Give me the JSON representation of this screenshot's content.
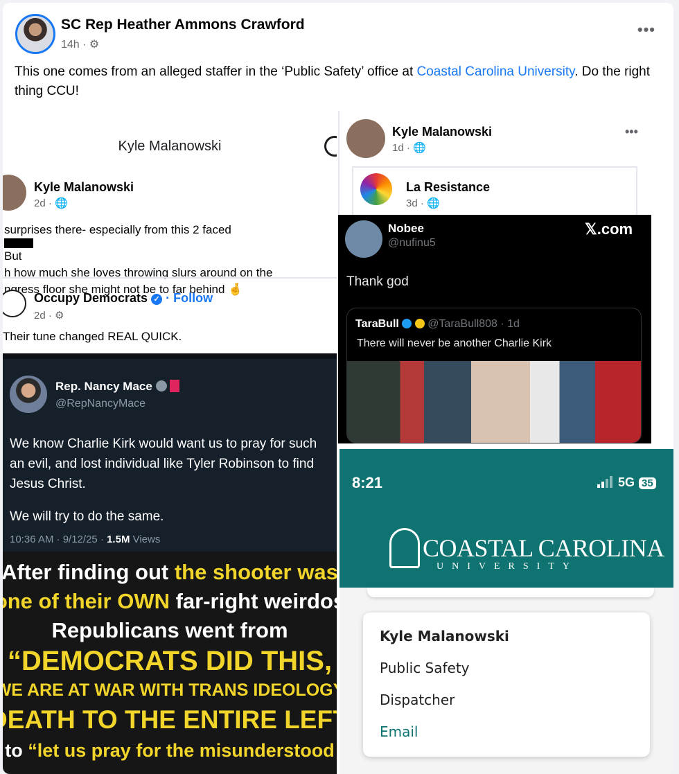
{
  "post": {
    "author": "SC Rep Heather Ammons Crawford",
    "time": "14h · ⚙",
    "more": "•••",
    "text_before": "This one comes from an alleged staffer in the ‘Public Safety’ office at ",
    "link": "Coastal Carolina University",
    "text_after": ". Do the right thing CCU!"
  },
  "left_screenshot": {
    "title": "Kyle Malanowski",
    "post_author": "Kyle Malanowski",
    "post_time": "2d · 🌐",
    "lines": [
      "surprises there- especially from this 2 faced",
      "But",
      "h how much she loves throwing slurs around on the",
      "ngress floor she might not be to far behind 🤞"
    ],
    "shared_page": "Occupy Democrats",
    "shared_follow": "· Follow",
    "shared_time": "2d · ⚙",
    "shared_text": "Their tune changed REAL QUICK.",
    "tweet": {
      "name": "Rep. Nancy Mace",
      "handle": "@RepNancyMace",
      "body1": "We know Charlie Kirk would want us to pray for such an evil, and lost individual like Tyler Robinson to find Jesus Christ.",
      "body2": "We will try to do the same.",
      "footer": "10:36 AM · 9/12/25 · ",
      "views_count": "1.5M",
      "views_label": " Views"
    },
    "meme": {
      "l1a": "After finding out ",
      "l1b": "the shooter was",
      "l2a": "one of their OWN",
      "l2b": " far-right weirdos",
      "l3": "Republicans went from",
      "l4": "“DEMOCRATS DID THIS,",
      "l5": "WE ARE AT WAR WITH TRANS IDEOLOGY",
      "l6": "DEATH TO THE ENTIRE LEFT”",
      "l7a": "to ",
      "l7b": "“let us pray for the misunderstood"
    }
  },
  "right_screenshot": {
    "author": "Kyle Malanowski",
    "time": "1d · 🌐",
    "more": "•••",
    "shared_page": "La Resistance",
    "shared_time": "3d · 🌐",
    "x": {
      "name": "Nobee",
      "handle": "@nufinu5",
      "brand": "𝕏.com",
      "body": "Thank god",
      "quote_name": "TaraBull",
      "quote_handle": "@TaraBull808 · 1d",
      "quote_text": "There will never be another Charlie Kirk"
    },
    "phone": {
      "time": "8:21",
      "network": "5G",
      "battery": "35",
      "logo": "COASTAL CAROLINA",
      "logo_sub": "UNIVERSITY",
      "staff_name": "Kyle Malanowski",
      "department": "Public Safety",
      "job_title": "Dispatcher",
      "email_label": "Email"
    }
  },
  "colors": {
    "facebook_blue": "#1877f2",
    "ccu_teal": "#0f7471",
    "meme_yellow": "#f2d52a"
  }
}
